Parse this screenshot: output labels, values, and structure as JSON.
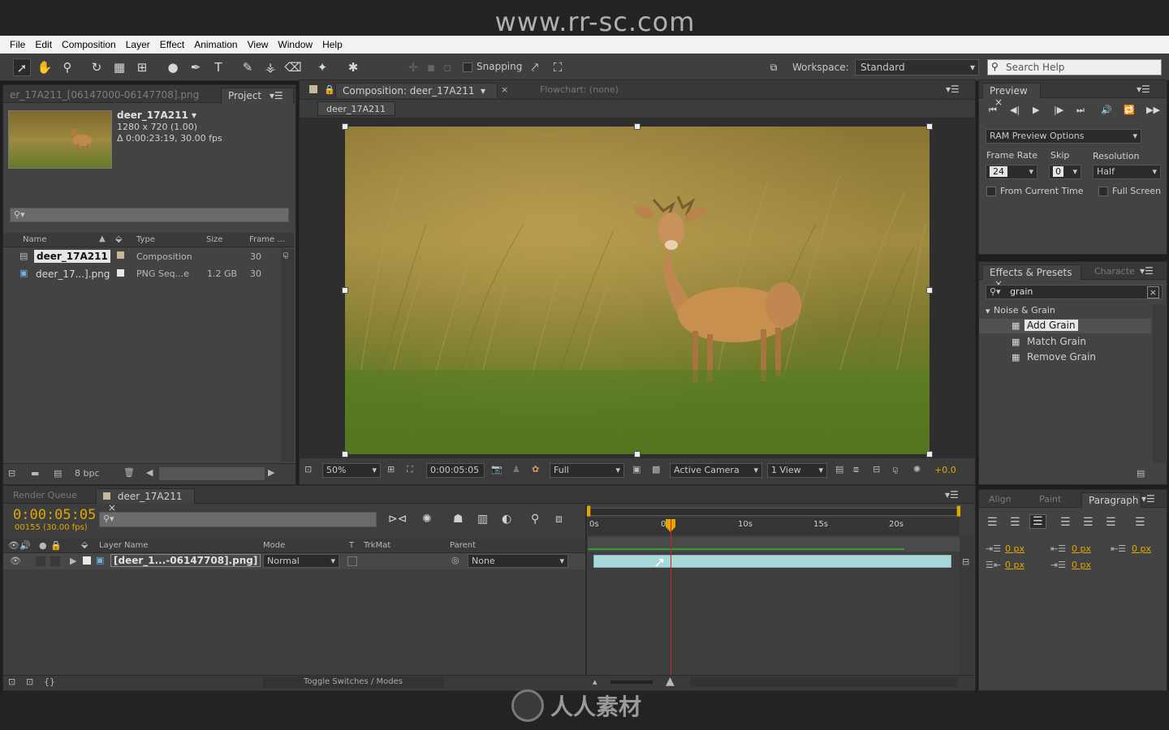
{
  "banner": {
    "url": "www.rr-sc.com",
    "brand": "人人素材"
  },
  "menu": [
    "File",
    "Edit",
    "Composition",
    "Layer",
    "Effect",
    "Animation",
    "View",
    "Window",
    "Help"
  ],
  "toolbar": {
    "snapping": "Snapping",
    "workspace_label": "Workspace:",
    "workspace_value": "Standard",
    "search_placeholder": "Search Help"
  },
  "project": {
    "source_tab": "er_17A211_[06147000-06147708].png",
    "tab": "Project",
    "comp_name": "deer_17A211 ▾",
    "comp_dims": "1280 x 720 (1.00)",
    "comp_duration": "Δ 0:00:23:19, 30.00 fps",
    "columns": [
      "Name",
      "Type",
      "Size",
      "Frame ..."
    ],
    "rows": [
      {
        "name": "deer_17A211",
        "type": "Composition",
        "size": "",
        "frame": "30"
      },
      {
        "name": "deer_17...].png",
        "type": "PNG Seq...e",
        "size": "1.2 GB",
        "frame": "30"
      }
    ],
    "bpc": "8 bpc"
  },
  "composition": {
    "tab": "Composition: deer_17A211",
    "flowchart": "Flowchart: (none)",
    "subtab": "deer_17A211",
    "zoom": "50%",
    "timecode": "0:00:05:05",
    "quality": "Full",
    "camera": "Active Camera",
    "views": "1 View",
    "exposure": "+0.0"
  },
  "preview": {
    "tab": "Preview",
    "options": "RAM Preview Options",
    "frame_rate_label": "Frame Rate",
    "skip_label": "Skip",
    "resolution_label": "Resolution",
    "frame_rate": "24",
    "skip": "0",
    "resolution": "Half",
    "from_current": "From Current Time",
    "full_screen": "Full Screen"
  },
  "effects": {
    "tab": "Effects & Presets",
    "tab2": "Characte",
    "search": "grain",
    "category": "Noise & Grain",
    "items": [
      "Add Grain",
      "Match Grain",
      "Remove Grain"
    ]
  },
  "paragraph": {
    "tabs": [
      "Align",
      "Paint",
      "Paragraph"
    ],
    "values": [
      "0 px",
      "0 px",
      "0 px",
      "0 px",
      "0 px"
    ]
  },
  "timeline": {
    "tab_render": "Render Queue",
    "tab_comp": "deer_17A211",
    "current_time": "0:00:05:05",
    "frame_info": "00155 (30.00 fps)",
    "columns": [
      "Layer Name",
      "Mode",
      "T",
      "TrkMat",
      "Parent"
    ],
    "layer": {
      "name": "[deer_1...-06147708].png]",
      "mode": "Normal",
      "parent": "None"
    },
    "ruler": [
      "0s",
      "05s",
      "10s",
      "15s",
      "20s"
    ],
    "toggle": "Toggle Switches / Modes"
  },
  "watermark": {
    "cn": "人人素材",
    "url": "www.rr-sc.com"
  },
  "colors": {
    "timecode": "#e2a800",
    "playhead": "#d02020",
    "layer_bar": "#a9d8d8"
  }
}
